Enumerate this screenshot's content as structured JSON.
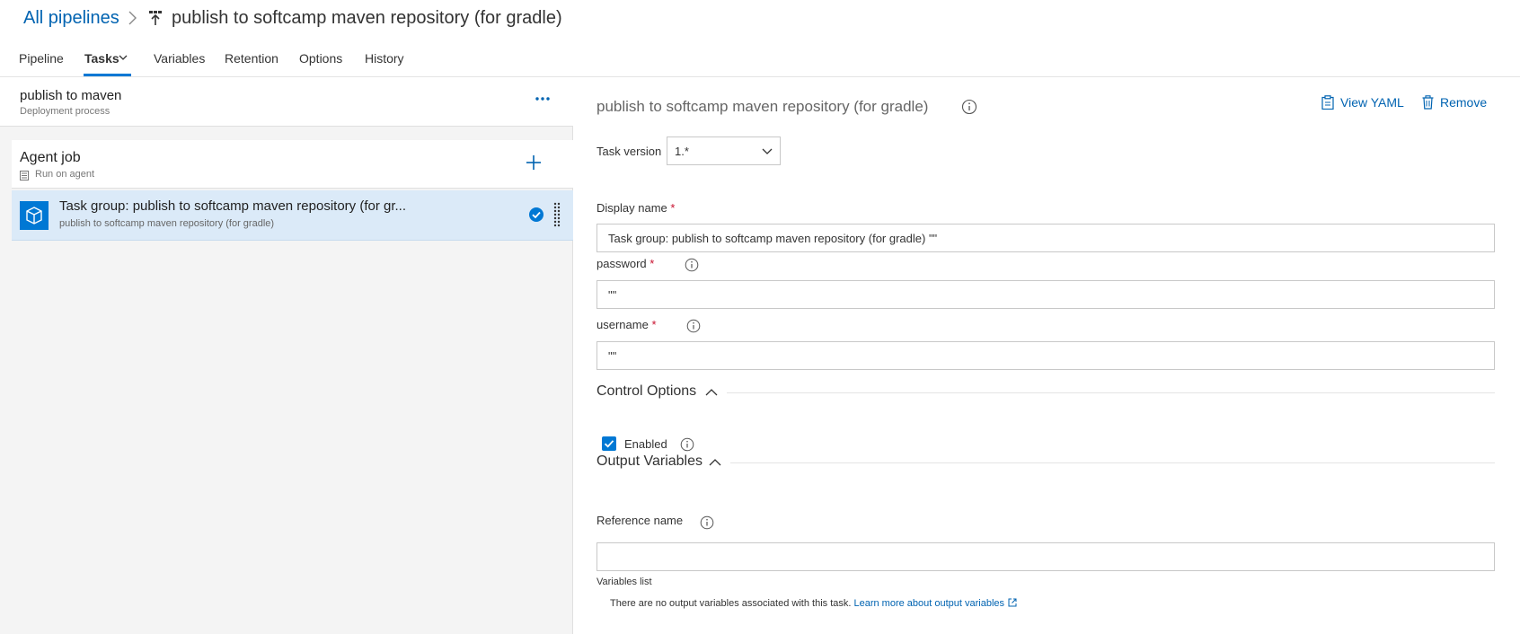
{
  "header": {
    "breadcrumb_link": "All pipelines",
    "title": "publish to softcamp maven repository (for gradle)"
  },
  "tabs": [
    {
      "label": "Pipeline",
      "active": false
    },
    {
      "label": "Tasks",
      "active": true
    },
    {
      "label": "Variables",
      "active": false
    },
    {
      "label": "Retention",
      "active": false
    },
    {
      "label": "Options",
      "active": false
    },
    {
      "label": "History",
      "active": false
    }
  ],
  "left": {
    "process_name": "publish to maven",
    "process_sub": "Deployment process",
    "agent_job": {
      "title": "Agent job",
      "subtitle": "Run on agent"
    },
    "task": {
      "title": "Task group: publish to softcamp maven repository (for gr...",
      "subtitle": "publish to softcamp maven repository (for gradle)"
    }
  },
  "right": {
    "title": "publish to softcamp maven repository (for gradle)",
    "view_yaml": "View YAML",
    "remove": "Remove",
    "task_version_label": "Task version",
    "task_version_value": "1.*",
    "display_name_label": "Display name",
    "display_name_value": "Task group: publish to softcamp maven repository (for gradle) \"\"",
    "password_label": "password",
    "password_value": "\"\"",
    "username_label": "username",
    "username_value": "\"\"",
    "required_mark": "*",
    "control_options_label": "Control Options",
    "enabled_label": "Enabled",
    "output_variables_label": "Output Variables",
    "reference_name_label": "Reference name",
    "reference_name_value": "",
    "variables_list_label": "Variables list",
    "no_output_text": "There are no output variables associated with this task.",
    "learn_more": "Learn more about output variables"
  },
  "colors": {
    "accent": "#0078d4",
    "link": "#0063b1",
    "selected_row": "#dbeaf8",
    "required": "#c8102e"
  }
}
